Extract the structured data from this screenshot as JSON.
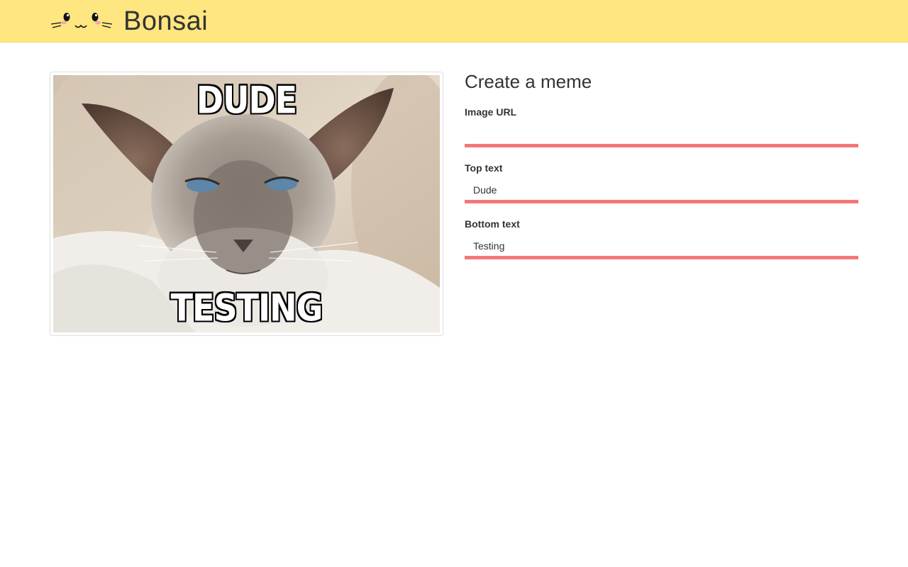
{
  "header": {
    "brand_name": "Bonsai",
    "logo_icon": "cat-face-icon",
    "background_color": "#fee680"
  },
  "meme": {
    "top_text": "DUDE",
    "bottom_text": "TESTING",
    "image_icon": "siamese-cat-photo"
  },
  "form": {
    "title": "Create a meme",
    "image_url": {
      "label": "Image URL",
      "value": ""
    },
    "top_text": {
      "label": "Top text",
      "value": "Dude"
    },
    "bottom_text": {
      "label": "Bottom text",
      "value": "Testing"
    },
    "accent_color": "#f57777"
  }
}
